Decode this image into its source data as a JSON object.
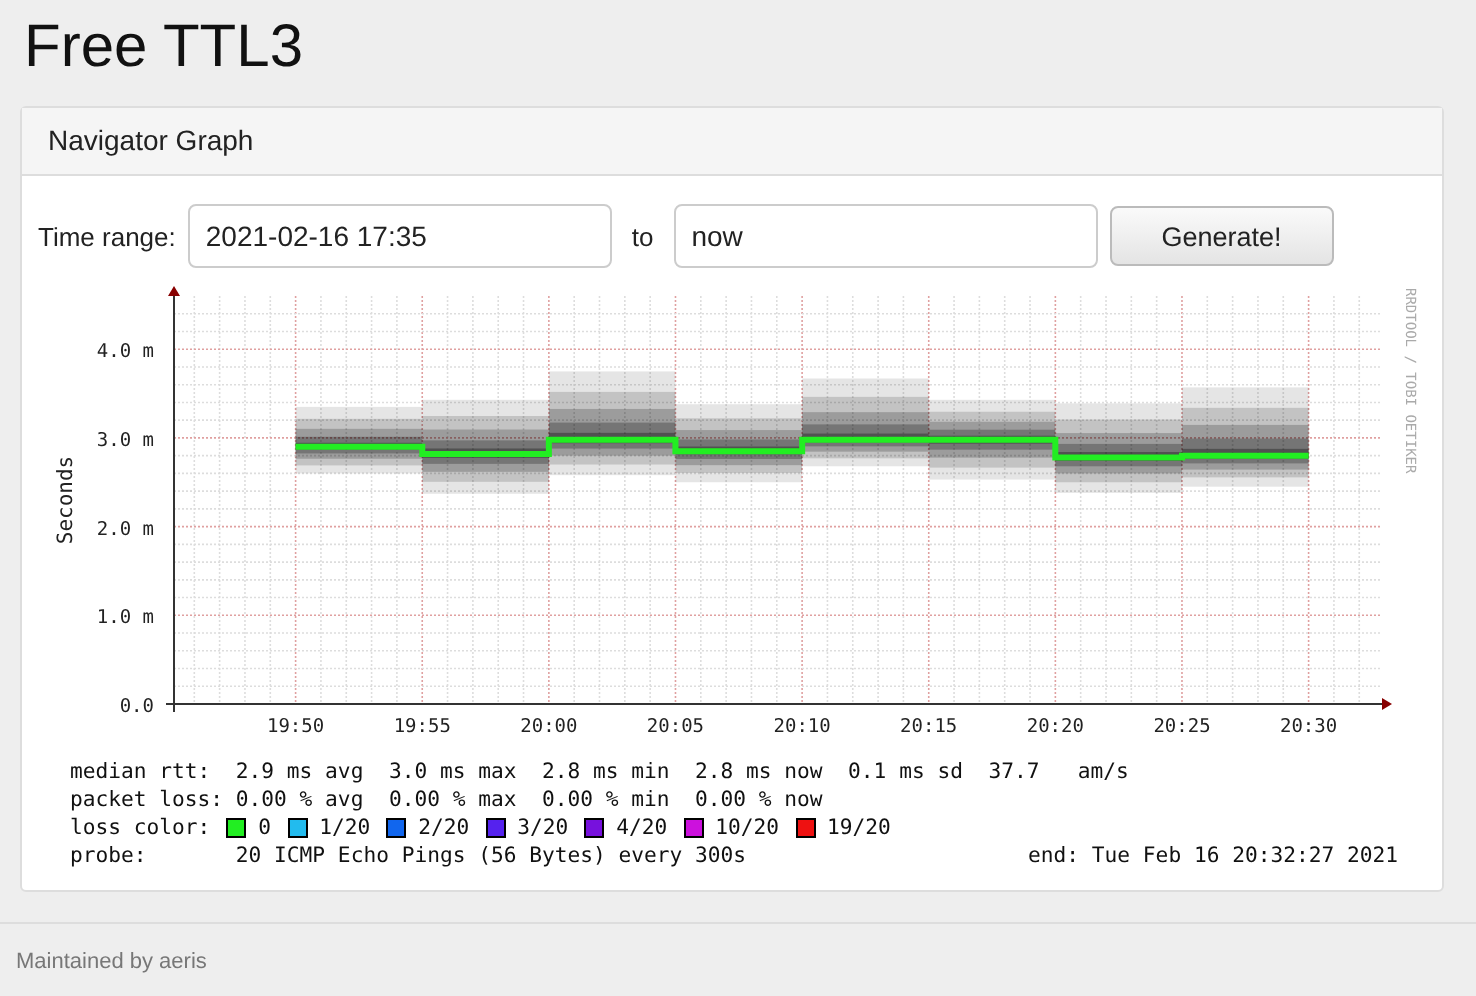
{
  "page_title": "Free TTL3",
  "panel": {
    "title": "Navigator Graph"
  },
  "form": {
    "label": "Time range:",
    "from_value": "2021-02-16 17:35",
    "to_label": "to",
    "to_value": "now",
    "button": "Generate!"
  },
  "graph": {
    "side_label": "RRDTOOL / TOBI OETIKER",
    "chart_data": {
      "type": "line",
      "ylabel": "Seconds",
      "xlim": [
        19.7533,
        20.5483
      ],
      "ylim": [
        0,
        4.6
      ],
      "grid": true,
      "xticks": [
        {
          "value": 19.8333,
          "label": "19:50"
        },
        {
          "value": 19.9167,
          "label": "19:55"
        },
        {
          "value": 20,
          "label": "20:00"
        },
        {
          "value": 20.0833,
          "label": "20:05"
        },
        {
          "value": 20.1667,
          "label": "20:10"
        },
        {
          "value": 20.25,
          "label": "20:15"
        },
        {
          "value": 20.3333,
          "label": "20:20"
        },
        {
          "value": 20.4167,
          "label": "20:25"
        },
        {
          "value": 20.5,
          "label": "20:30"
        }
      ],
      "x": [
        19.8333,
        19.9167,
        19.9167,
        20,
        20,
        20.0833,
        20.0833,
        20.1667,
        20.1667,
        20.25,
        20.25,
        20.3333,
        20.3333,
        20.4167,
        20.4167,
        20.5
      ],
      "yticks": [
        {
          "value": 0,
          "label": "0.0"
        },
        {
          "value": 1,
          "label": "1.0 m"
        },
        {
          "value": 2,
          "label": "2.0 m"
        },
        {
          "value": 3,
          "label": "3.0 m"
        },
        {
          "value": 4,
          "label": "4.0 m"
        }
      ],
      "series": [
        {
          "color": "#22ee22",
          "values": [
            2.9,
            2.9,
            2.82,
            2.82,
            2.98,
            2.98,
            2.85,
            2.85,
            2.98,
            2.98,
            2.98,
            2.98,
            2.78,
            2.78,
            2.8,
            2.8
          ]
        }
      ]
    }
  },
  "legend": {
    "rows": [
      {
        "kind": "text",
        "text": "median rtt:  2.9 ms avg  3.0 ms max  2.8 ms min  2.8 ms now  0.1 ms sd  37.7   am/s"
      },
      {
        "kind": "text",
        "text": "packet loss: 0.00 % avg  0.00 % max  0.00 % min  0.00 % now"
      },
      {
        "kind": "colors",
        "text": "loss color:",
        "items": [
          {
            "label": "0",
            "color": "#22ee22"
          },
          {
            "label": "1/20",
            "color": "#22bbee"
          },
          {
            "label": "2/20",
            "color": "#1166ee"
          },
          {
            "label": "3/20",
            "color": "#5522ee"
          },
          {
            "label": "4/20",
            "color": "#7711dd"
          },
          {
            "label": "10/20",
            "color": "#cc11dd"
          },
          {
            "label": "19/20",
            "color": "#ee1111"
          }
        ]
      },
      {
        "kind": "probe",
        "text": "probe:       20 ICMP Echo Pings (56 Bytes) every 300s",
        "end": "end: Tue Feb 16 20:32:27 2021"
      }
    ]
  },
  "footer": "Maintained by aeris"
}
